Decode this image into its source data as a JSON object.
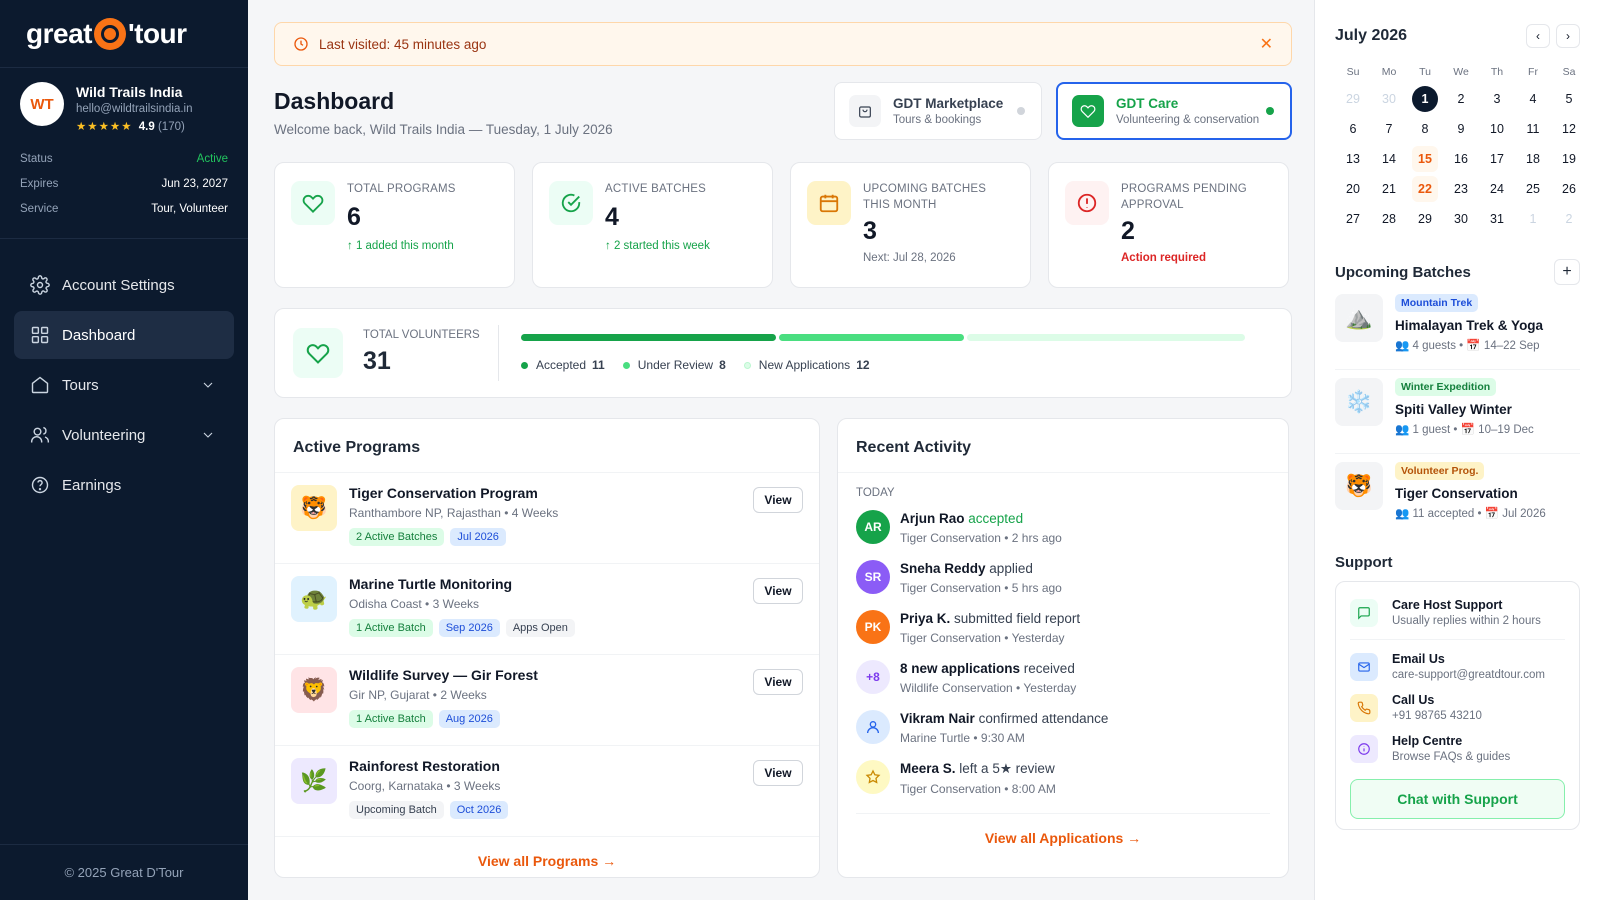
{
  "brand": {
    "left": "great",
    "right": "'tour"
  },
  "profile": {
    "initials": "WT",
    "name": "Wild Trails India",
    "email": "hello@wildtrailsindia.in",
    "stars": "★★★★★",
    "rating": "4.9",
    "reviews": "(170)"
  },
  "meta": [
    {
      "k": "Status",
      "v": "Active"
    },
    {
      "k": "Expires",
      "v": "Jun 23, 2027"
    },
    {
      "k": "Service",
      "v": "Tour, Volunteer"
    }
  ],
  "nav": {
    "account": "Account Settings",
    "dashboard": "Dashboard",
    "tours": "Tours",
    "volunteering": "Volunteering",
    "earnings": "Earnings"
  },
  "footer": "© 2025 Great D'Tour",
  "banner": {
    "text": "Last visited: 45 minutes ago",
    "close": "✕"
  },
  "page": {
    "title": "Dashboard",
    "subtitle": "Welcome back, Wild Trails India — Tuesday, 1 July 2026"
  },
  "switches": [
    {
      "title": "GDT Marketplace",
      "sub": "Tours & bookings"
    },
    {
      "title": "GDT Care",
      "sub": "Volunteering & conservation"
    }
  ],
  "stats": [
    {
      "label": "Total Programs",
      "value": "6",
      "note": "↑ 1 added this month"
    },
    {
      "label": "Active Batches",
      "value": "4",
      "note": "↑ 2 started this week"
    },
    {
      "label": "Upcoming Batches This Month",
      "value": "3",
      "note": "Next: Jul 28, 2026"
    },
    {
      "label": "Programs Pending Approval",
      "value": "2",
      "note": "Action required"
    }
  ],
  "volunteers": {
    "label": "Total Volunteers",
    "value": "31",
    "accepted_label": "Accepted",
    "accepted": 11,
    "review_label": "Under Review",
    "review": 8,
    "new_label": "New Applications",
    "new": 12,
    "colors": {
      "accepted": "#16a34a",
      "review": "#4ade80",
      "new": "#dcfce7"
    }
  },
  "programs": {
    "title": "Active Programs",
    "view": "View",
    "items": [
      {
        "name": "Tiger Conservation Program",
        "sub": "Ranthambore NP, Rajasthan • 4 Weeks",
        "tags": [
          "2 Active Batches",
          "Jul 2026"
        ]
      },
      {
        "name": "Marine Turtle Monitoring",
        "sub": "Odisha Coast • 3 Weeks",
        "tags": [
          "1 Active Batch",
          "Sep 2026",
          "Apps Open"
        ]
      },
      {
        "name": "Wildlife Survey — Gir Forest",
        "sub": "Gir NP, Gujarat • 2 Weeks",
        "tags": [
          "1 Active Batch",
          "Aug 2026"
        ]
      },
      {
        "name": "Rainforest Restoration",
        "sub": "Coorg, Karnataka • 3 Weeks",
        "tags": [
          "Upcoming Batch",
          "Oct 2026"
        ]
      }
    ],
    "footer": "View all Programs →"
  },
  "activity": {
    "title": "Recent Activity",
    "group": "TODAY",
    "items": [
      {
        "initials": "AR",
        "name": "Arjun Rao",
        "action": "accepted",
        "sub": "Tiger Conservation • 2 hrs ago"
      },
      {
        "initials": "SR",
        "name": "Sneha Reddy",
        "action": "applied",
        "sub": "Tiger Conservation • 5 hrs ago"
      },
      {
        "initials": "PK",
        "name": "Priya K.",
        "action": "submitted field report",
        "sub": "Tiger Conservation • Yesterday"
      },
      {
        "initials": "+8",
        "name": "8 new applications",
        "action": "received",
        "sub": "Wildlife Conservation • Yesterday"
      },
      {
        "initials": "",
        "name": "Vikram Nair",
        "action": "confirmed attendance",
        "sub": "Marine Turtle • 9:30 AM"
      },
      {
        "initials": "",
        "name": "Meera S.",
        "action": "left a 5★ review",
        "sub": "Tiger Conservation • 8:00 AM"
      }
    ],
    "footer": "View all Applications →"
  },
  "calendar": {
    "title": "July 2026",
    "prev": "‹",
    "next": "›",
    "days": [
      "Su",
      "Mo",
      "Tu",
      "We",
      "Th",
      "Fr",
      "Sa"
    ],
    "dates": [
      "29",
      "30",
      "1",
      "2",
      "3",
      "4",
      "5",
      "6",
      "7",
      "8",
      "9",
      "10",
      "11",
      "12",
      "13",
      "14",
      "15",
      "16",
      "17",
      "18",
      "19",
      "20",
      "21",
      "22",
      "23",
      "24",
      "25",
      "26",
      "27",
      "28",
      "29",
      "30",
      "31",
      "1",
      "2"
    ]
  },
  "batches": {
    "title": "Upcoming Batches",
    "add": "+",
    "items": [
      {
        "tag": "Mountain Trek",
        "name": "Himalayan Trek & Yoga",
        "sub": "👥 4 guests • 📅 14–22 Sep"
      },
      {
        "tag": "Winter Expedition",
        "name": "Spiti Valley Winter",
        "sub": "👥 1 guest • 📅 10–19 Dec"
      },
      {
        "tag": "Volunteer Prog.",
        "name": "Tiger Conservation",
        "sub": "👥 11 accepted • 📅 Jul 2026"
      }
    ]
  },
  "support": {
    "title": "Support",
    "items": [
      {
        "title": "Care Host Support",
        "sub": "Usually replies within 2 hours"
      },
      {
        "title": "Email Us",
        "sub": "care-support@greatdtour.com"
      },
      {
        "title": "Call Us",
        "sub": "+91 98765 43210"
      },
      {
        "title": "Help Centre",
        "sub": "Browse FAQs & guides"
      }
    ],
    "cta": "Chat with Support"
  }
}
